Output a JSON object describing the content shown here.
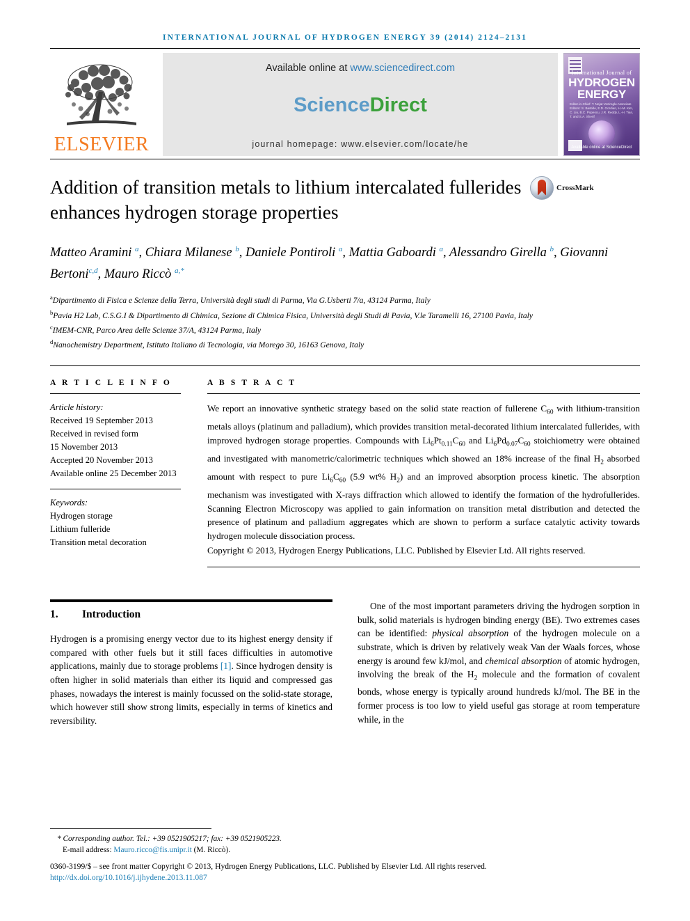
{
  "running_head": "INTERNATIONAL JOURNAL OF HYDROGEN ENERGY 39 (2014) 2124–2131",
  "masthead": {
    "publisher_name": "ELSEVIER",
    "publisher_logo_icon": "elsevier-tree-icon",
    "available_prefix": "Available online at ",
    "available_url": "www.sciencedirect.com",
    "brand_part1": "Science",
    "brand_part2": "Direct",
    "journal_homepage": "journal homepage: www.elsevier.com/locate/he",
    "cover": {
      "line1": "International Journal of",
      "line2": "HYDROGEN",
      "line3": "ENERGY",
      "editors": "Editor-in-Chief: T. Nejat Veziroglu\nAssociate Editors: S. Bastide, E.D. Gordian, H.-M. Kim, C. Liu,\nB.C. Popescu, J.R. Reddy,\nL.-H. Tian, T. and S.A. Sherif",
      "science_direct": "Available online at ScienceDirect",
      "els_icon": "elsevier-tree-icon",
      "ihe_icon": "ihe-logo-icon"
    }
  },
  "title": "Addition of transition metals to lithium intercalated fullerides enhances hydrogen storage properties",
  "crossmark": {
    "label": "CrossMark",
    "icon": "crossmark-icon"
  },
  "authors_html": "Matteo Aramini <sup>a</sup>, Chiara Milanese <sup>b</sup>, Daniele Pontiroli <sup>a</sup>, Mattia Gaboardi <sup>a</sup>, Alessandro Girella <sup>b</sup>, Giovanni Bertoni<sup>c,d</sup>, Mauro Riccò <sup>a,*</sup>",
  "affiliations": [
    {
      "marker": "a",
      "text": "Dipartimento di Fisica e Scienze della Terra, Università degli studi di Parma, Via G.Usberti 7/a, 43124 Parma, Italy"
    },
    {
      "marker": "b",
      "text": "Pavia H2 Lab, C.S.G.I & Dipartimento di Chimica, Sezione di Chimica Fisica, Università degli Studi di Pavia, V.le Taramelli 16, 27100 Pavia, Italy"
    },
    {
      "marker": "c",
      "text": "IMEM-CNR, Parco Area delle Scienze 37/A, 43124 Parma, Italy"
    },
    {
      "marker": "d",
      "text": "Nanochemistry Department, Istituto Italiano di Tecnologia, via Morego 30, 16163 Genova, Italy"
    }
  ],
  "article_info": {
    "heading": "A R T I C L E   I N F O",
    "history_label": "Article history:",
    "history": [
      "Received 19 September 2013",
      "Received in revised form",
      "15 November 2013",
      "Accepted 20 November 2013",
      "Available online 25 December 2013"
    ],
    "keywords_label": "Keywords:",
    "keywords": [
      "Hydrogen storage",
      "Lithium fulleride",
      "Transition metal decoration"
    ]
  },
  "abstract": {
    "heading": "A B S T R A C T",
    "body": "We report an innovative synthetic strategy based on the solid state reaction of fullerene C60 with lithium-transition metals alloys (platinum and palladium), which provides transition metal-decorated lithium intercalated fullerides, with improved hydrogen storage properties. Compounds with Li6Pt0.11C60 and Li6Pd0.07C60 stoichiometry were obtained and investigated with manometric/calorimetric techniques which showed an 18% increase of the final H2 absorbed amount with respect to pure Li6C60 (5.9 wt% H2) and an improved absorption process kinetic. The absorption mechanism was investigated with X-rays diffraction which allowed to identify the formation of the hydrofullerides. Scanning Electron Microscopy was applied to gain information on transition metal distribution and detected the presence of platinum and palladium aggregates which are shown to perform a surface catalytic activity towards hydrogen molecule dissociation process.",
    "copyright": "Copyright © 2013, Hydrogen Energy Publications, LLC. Published by Elsevier Ltd. All rights reserved."
  },
  "introduction": {
    "number": "1.",
    "title": "Introduction",
    "paragraph1": "Hydrogen is a promising energy vector due to its highest energy density if compared with other fuels but it still faces difficulties in automotive applications, mainly due to storage problems [1]. Since hydrogen density is often higher in solid materials than either its liquid and compressed gas phases, nowadays the interest is mainly focussed on the solid-state storage, which however still show strong limits, especially in terms of kinetics and reversibility.",
    "paragraph1_ref": "[1]",
    "right_paragraph": "One of the most important parameters driving the hydrogen sorption in bulk, solid materials is hydrogen binding energy (BE). Two extremes cases can be identified: physical absorption of the hydrogen molecule on a substrate, which is driven by relatively weak Van der Waals forces, whose energy is around few kJ/mol, and chemical absorption of atomic hydrogen, involving the break of the H2 molecule and the formation of covalent bonds, whose energy is typically around hundreds kJ/mol. The BE in the former process is too low to yield useful gas storage at room temperature while, in the"
  },
  "footnote": {
    "corresponding": "* Corresponding author. Tel.: +39 0521905217; fax: +39 0521905223.",
    "email_label": "E-mail address: ",
    "email": "Mauro.ricco@fis.unipr.it",
    "email_suffix": " (M. Riccò).",
    "issn_copyright": "0360-3199/$ – see front matter Copyright © 2013, Hydrogen Energy Publications, LLC. Published by Elsevier Ltd. All rights reserved.",
    "doi": "http://dx.doi.org/10.1016/j.ijhydene.2013.11.087"
  },
  "colors": {
    "link": "#1e7fb5",
    "running_head": "#0c7aad",
    "elsevier_orange": "#F47B20",
    "sciencedirect_blue": "#5d9cc8",
    "sciencedirect_green": "#3ca13c"
  }
}
